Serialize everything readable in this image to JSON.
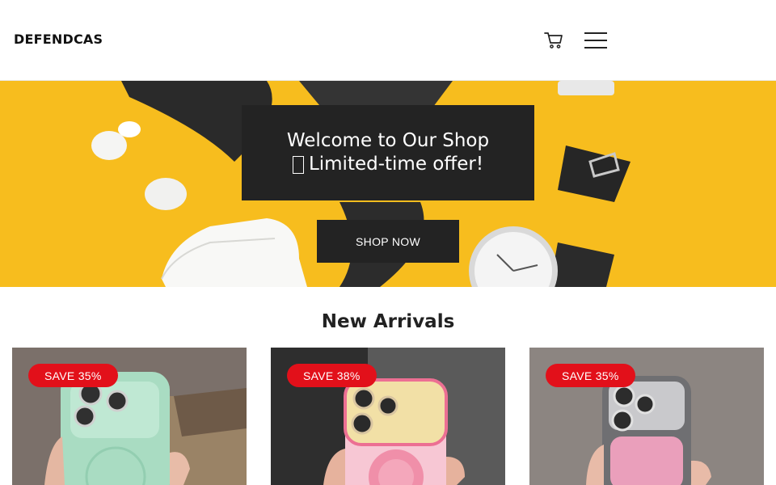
{
  "header": {
    "logo": "DEFENDCAS",
    "icons": {
      "cart": "cart-icon",
      "menu": "hamburger-menu-icon"
    }
  },
  "hero": {
    "title": "Welcome to Our Shop",
    "subtitle": "Limited-time offer!",
    "subtitle_icon": "gift-box-icon",
    "cta": "SHOP NOW",
    "background_color": "#f7bd1e"
  },
  "arrivals": {
    "title": "New Arrivals",
    "products": [
      {
        "badge": "SAVE 35%",
        "case_color": "mint-green"
      },
      {
        "badge": "SAVE 38%",
        "case_color": "pink"
      },
      {
        "badge": "SAVE 35%",
        "case_color": "silver-pink"
      }
    ]
  },
  "colors": {
    "accent": "#e2101a",
    "dark": "#232323"
  }
}
